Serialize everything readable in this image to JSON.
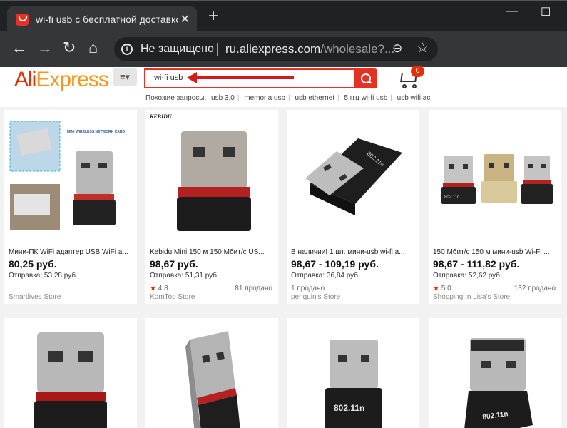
{
  "browser": {
    "tab_title": "wi-fi usb с бесплатной доставко",
    "tab_close": "✕",
    "new_tab": "+",
    "window_minimize": "—",
    "window_maximize": "☐",
    "back": "←",
    "forward": "→",
    "reload": "↻",
    "home": "⌂",
    "security_label": "Не защищено",
    "url_host": "ru.aliexpress.com",
    "url_path": "/wholesale?...",
    "icons": [
      "aliexpress-favicon",
      "info-icon",
      "zoom-icon",
      "star-icon"
    ]
  },
  "header": {
    "logo_part1": "Ali",
    "logo_part2": "Express",
    "menu_label": "≡▾",
    "search_value": "wi-fi usb",
    "cart_count": "0",
    "related_label": "Похожие запросы:",
    "related_queries": [
      "usb 3,0",
      "memoria usb",
      "usb ethernet",
      "5 ггц wi-fi usb",
      "usb wifi ac"
    ],
    "colors": {
      "brand_red": "#e62e04",
      "brand_orange": "#f7971d",
      "search_border": "#e43225"
    }
  },
  "products": [
    {
      "title": "Мини-ПК WiFi адаптер USB WiFi а...",
      "price": "80,25 руб.",
      "shipping": "Отправка: 53,28 руб.",
      "rating_star": "",
      "rating": "",
      "sold": "",
      "store": "Smartlives Store",
      "image_text": "MINI WIRELESS NETWORK CARD"
    },
    {
      "title": "Kebidu Mini 150 м 150 Мбит/с US...",
      "price": "98,67 руб.",
      "shipping": "Отправка: 51,31 руб.",
      "rating_star": "★",
      "rating": "4.8",
      "sold": "81 продано",
      "store": "KomTop Store",
      "image_text": "KEBIDU"
    },
    {
      "title": "В наличии! 1 шт. мини-usb wi-fi а...",
      "price": "98,67 - 109,19 руб.",
      "shipping": "Отправка: 36,84 руб.",
      "rating_star": "",
      "rating": "1 продано",
      "sold": "",
      "store": "penguin's Store",
      "image_text": "802.11n"
    },
    {
      "title": "150 Мбит/с 150 м мини-usb Wi-Fi ...",
      "price": "98,67 - 111,82 руб.",
      "shipping": "Отправка: 52,62 руб.",
      "rating_star": "★",
      "rating": "5.0",
      "sold": "132 продано",
      "store": "Shopping In Lisa's Store",
      "image_text": "802.11n"
    },
    {
      "image_text": ""
    },
    {
      "image_text": ""
    },
    {
      "image_text": "802.11n"
    },
    {
      "image_text": "802.11n"
    }
  ]
}
